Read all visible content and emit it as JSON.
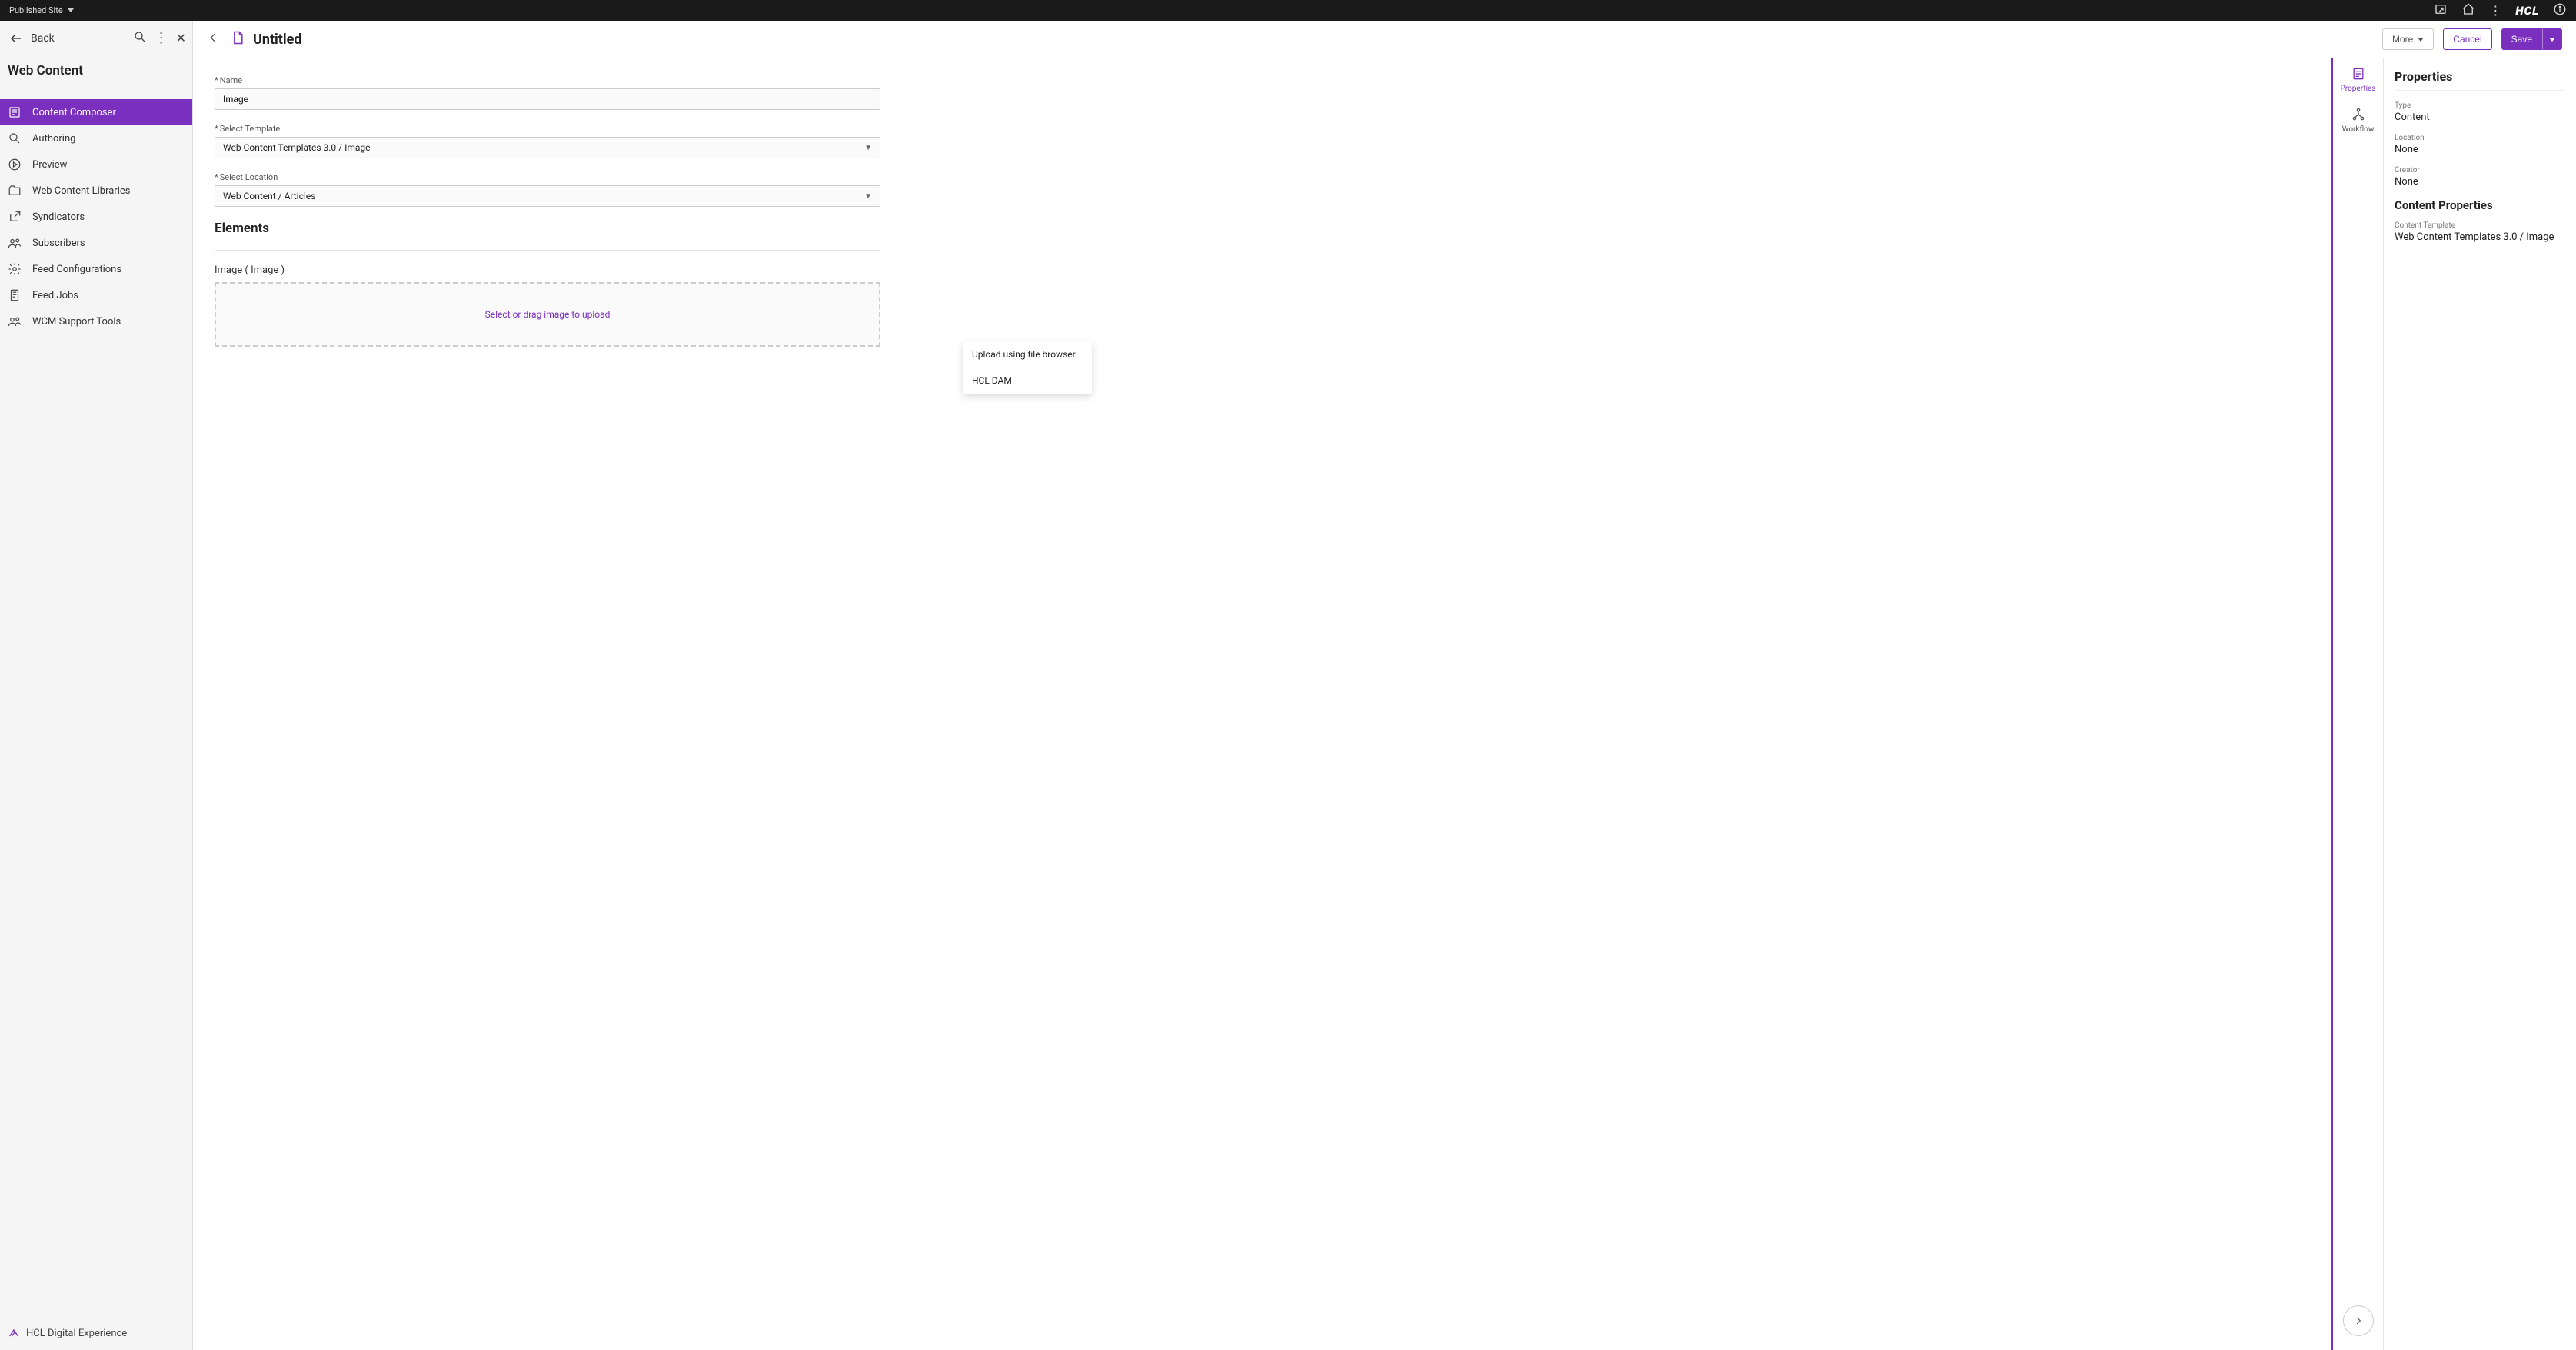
{
  "topbar": {
    "siteLabel": "Published Site"
  },
  "sidebar": {
    "back": "Back",
    "title": "Web Content",
    "items": [
      {
        "label": "Content Composer"
      },
      {
        "label": "Authoring"
      },
      {
        "label": "Preview"
      },
      {
        "label": "Web Content Libraries"
      },
      {
        "label": "Syndicators"
      },
      {
        "label": "Subscribers"
      },
      {
        "label": "Feed Configurations"
      },
      {
        "label": "Feed Jobs"
      },
      {
        "label": "WCM Support Tools"
      }
    ],
    "footer": "HCL Digital Experience"
  },
  "header": {
    "title": "Untitled",
    "more": "More",
    "cancel": "Cancel",
    "save": "Save"
  },
  "form": {
    "nameLabel": "Name",
    "nameValue": "Image",
    "templateLabel": "Select Template",
    "templateValue": "Web Content Templates 3.0 / Image",
    "locationLabel": "Select Location",
    "locationValue": "Web Content / Articles",
    "elementsTitle": "Elements",
    "elementLabel": "Image ( Image )",
    "dropzoneText": "Select or drag image to upload"
  },
  "popup": {
    "uploadBrowser": "Upload using file browser",
    "hclDam": "HCL DAM"
  },
  "rail": {
    "properties": "Properties",
    "workflow": "Workflow"
  },
  "properties": {
    "title": "Properties",
    "typeLabel": "Type",
    "typeValue": "Content",
    "locationLabel": "Location",
    "locationValue": "None",
    "creatorLabel": "Creator",
    "creatorValue": "None",
    "contentPropsTitle": "Content Properties",
    "contentTemplateLabel": "Content Template",
    "contentTemplateValue": "Web Content Templates 3.0 / Image"
  }
}
